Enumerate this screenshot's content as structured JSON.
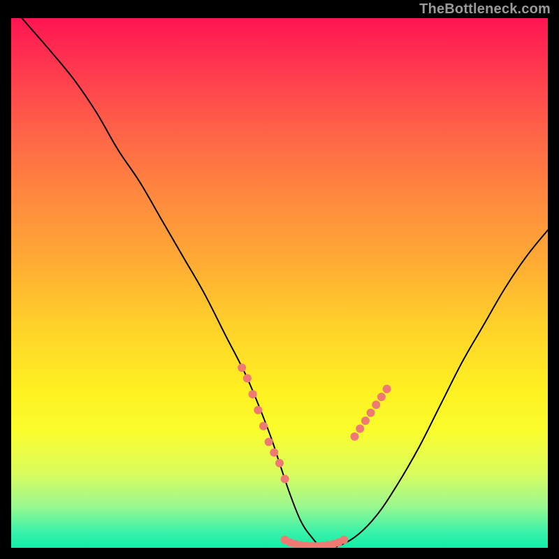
{
  "watermark": "TheBottleneck.com",
  "chart_data": {
    "type": "line",
    "title": "",
    "xlabel": "",
    "ylabel": "",
    "xlim": [
      0,
      100
    ],
    "ylim": [
      0,
      100
    ],
    "grid": false,
    "legend": false,
    "series": [
      {
        "name": "curve",
        "color": "#000000",
        "x": [
          2,
          8,
          12,
          16,
          20,
          24,
          28,
          32,
          36,
          40,
          44,
          48,
          50,
          52,
          54,
          56,
          58,
          60,
          64,
          68,
          72,
          76,
          80,
          84,
          88,
          92,
          96,
          100
        ],
        "values": [
          100,
          93,
          88,
          82,
          75,
          69,
          62,
          55,
          48,
          40,
          32,
          22,
          16,
          10,
          5,
          2,
          0,
          0,
          2,
          6,
          12,
          19,
          27,
          35,
          42,
          49,
          55,
          60
        ]
      },
      {
        "name": "left-highlight",
        "color": "#ef7a74",
        "style": "dots",
        "x": [
          43,
          44,
          45,
          46,
          47,
          48,
          49,
          50,
          51
        ],
        "values": [
          34,
          32,
          29,
          26,
          23,
          20,
          18,
          16,
          13
        ]
      },
      {
        "name": "floor-highlight",
        "color": "#ef7a74",
        "style": "dots",
        "x": [
          51,
          52,
          53,
          54,
          55,
          56,
          57,
          58,
          59,
          60,
          61,
          62
        ],
        "values": [
          1.5,
          1.0,
          0.7,
          0.5,
          0.4,
          0.3,
          0.3,
          0.4,
          0.5,
          0.7,
          1.0,
          1.5
        ]
      },
      {
        "name": "right-highlight",
        "color": "#ef7a74",
        "style": "dots",
        "x": [
          64,
          65,
          66,
          67,
          68,
          69,
          70
        ],
        "values": [
          21,
          22.5,
          24,
          25.5,
          27,
          28.5,
          30
        ]
      }
    ],
    "gradient_stops": [
      {
        "pos": 0.0,
        "color": "#ff1552"
      },
      {
        "pos": 0.1,
        "color": "#ff3a4f"
      },
      {
        "pos": 0.22,
        "color": "#ff6547"
      },
      {
        "pos": 0.34,
        "color": "#ff8a3e"
      },
      {
        "pos": 0.46,
        "color": "#ffab34"
      },
      {
        "pos": 0.58,
        "color": "#ffd12a"
      },
      {
        "pos": 0.7,
        "color": "#fff021"
      },
      {
        "pos": 0.78,
        "color": "#fafd2c"
      },
      {
        "pos": 0.86,
        "color": "#d9fc5e"
      },
      {
        "pos": 0.92,
        "color": "#9cf88e"
      },
      {
        "pos": 0.97,
        "color": "#3af2a9"
      },
      {
        "pos": 1.0,
        "color": "#0feea7"
      }
    ]
  }
}
